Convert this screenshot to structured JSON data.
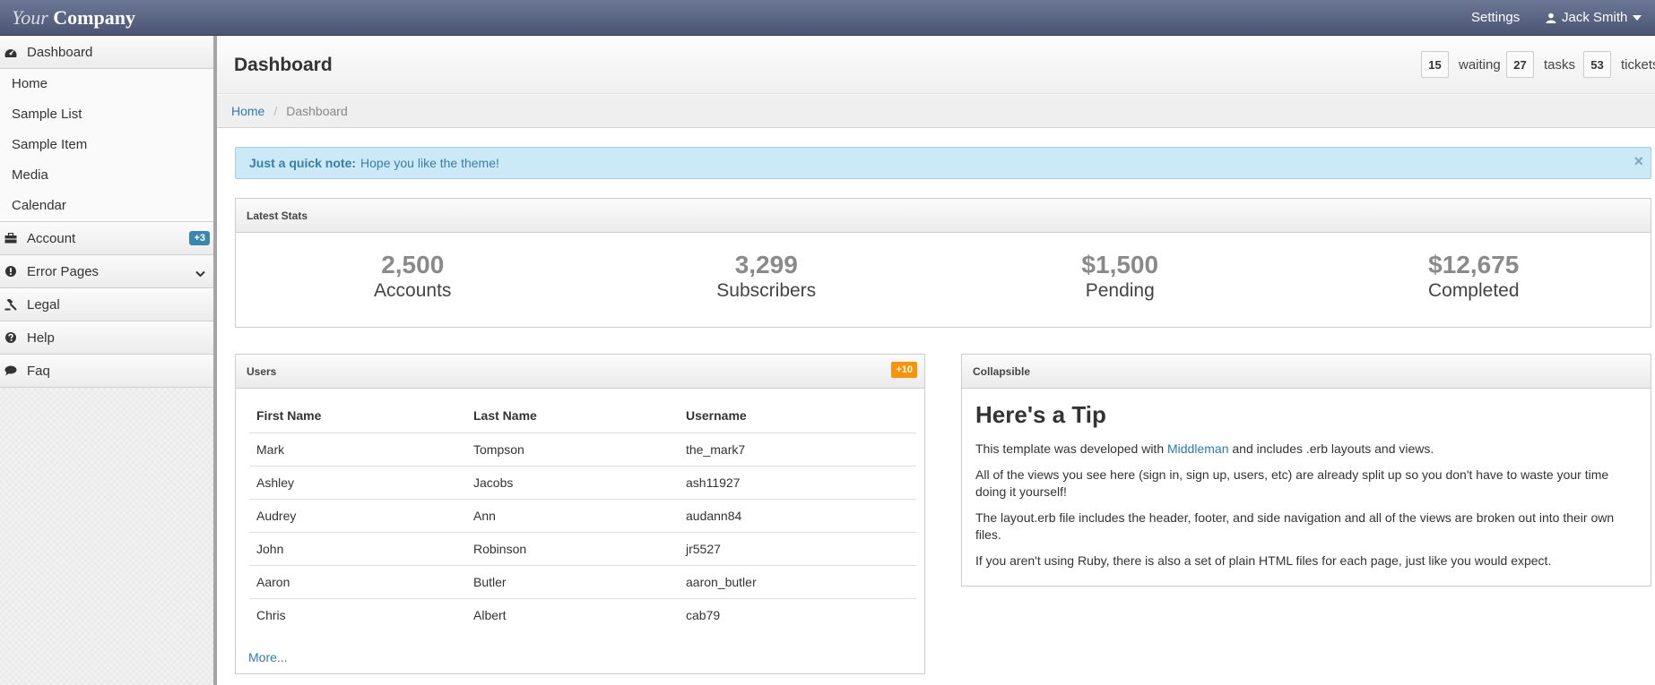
{
  "brand": {
    "word1": "Your",
    "word2": "Company"
  },
  "navbar": {
    "settings": "Settings",
    "user_name": "Jack Smith"
  },
  "sidebar": {
    "dashboard": "Dashboard",
    "sub_items": [
      "Home",
      "Sample List",
      "Sample Item",
      "Media",
      "Calendar"
    ],
    "account": "Account",
    "account_badge": "+3",
    "error_pages": "Error Pages",
    "legal": "Legal",
    "help": "Help",
    "faq": "Faq"
  },
  "header": {
    "title": "Dashboard",
    "counters": [
      {
        "value": "15",
        "label": "waiting"
      },
      {
        "value": "27",
        "label": "tasks"
      },
      {
        "value": "53",
        "label": "tickets"
      }
    ]
  },
  "breadcrumb": {
    "home": "Home",
    "current": "Dashboard"
  },
  "alert": {
    "strong": "Just a quick note:",
    "text": "Hope you like the theme!",
    "close": "×"
  },
  "latest_stats": {
    "title": "Latest Stats",
    "items": [
      {
        "value": "2,500",
        "label": "Accounts"
      },
      {
        "value": "3,299",
        "label": "Subscribers"
      },
      {
        "value": "$1,500",
        "label": "Pending"
      },
      {
        "value": "$12,675",
        "label": "Completed"
      }
    ]
  },
  "users": {
    "title": "Users",
    "badge": "+10",
    "columns": [
      "First Name",
      "Last Name",
      "Username"
    ],
    "rows": [
      [
        "Mark",
        "Tompson",
        "the_mark7"
      ],
      [
        "Ashley",
        "Jacobs",
        "ash11927"
      ],
      [
        "Audrey",
        "Ann",
        "audann84"
      ],
      [
        "John",
        "Robinson",
        "jr5527"
      ],
      [
        "Aaron",
        "Butler",
        "aaron_butler"
      ],
      [
        "Chris",
        "Albert",
        "cab79"
      ]
    ],
    "more": "More..."
  },
  "collapsible": {
    "title": "Collapsible",
    "heading": "Here's a Tip",
    "p1_before": "This template was developed with",
    "p1_link": "Middleman",
    "p1_after": "and includes .erb layouts and views.",
    "p2": "All of the views you see here (sign in, sign up, users, etc) are already split up so you don't have to waste your time doing it yourself!",
    "p3": "The layout.erb file includes the header, footer, and side navigation and all of the views are broken out into their own files.",
    "p4": "If you aren't using Ruby, there is also a set of plain HTML files for each page, just like you would expect."
  }
}
